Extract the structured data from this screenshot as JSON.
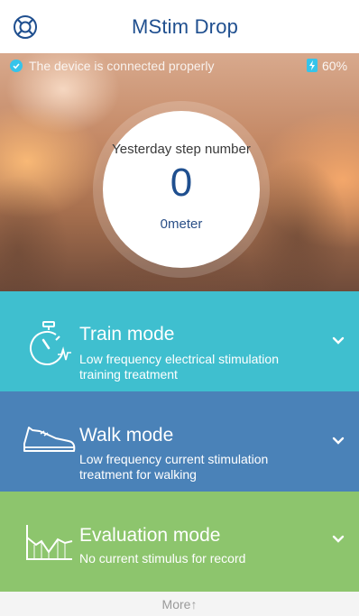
{
  "app": {
    "title": "MStim Drop"
  },
  "status": {
    "connection_text": "The device is connected properly",
    "battery_text": "60%",
    "battery_level": 0.6
  },
  "steps": {
    "label": "Yesterday step number",
    "value": "0",
    "distance": "0meter"
  },
  "modes": [
    {
      "title": "Train mode",
      "description": "Low frequency electrical stimulation training treatment",
      "icon": "stopwatch-icon",
      "color": "#3fbfcf"
    },
    {
      "title": "Walk mode",
      "description": "Low frequency current stimulation treatment for walking",
      "icon": "shoe-icon",
      "color": "#4a82b8"
    },
    {
      "title": "Evaluation mode",
      "description": "No current stimulus for record",
      "icon": "line-chart-icon",
      "color": "#8dc56d"
    }
  ],
  "footer": {
    "more_label": "More↑"
  },
  "colors": {
    "accent": "#1f4f8f",
    "status_icon": "#36c4ea"
  }
}
